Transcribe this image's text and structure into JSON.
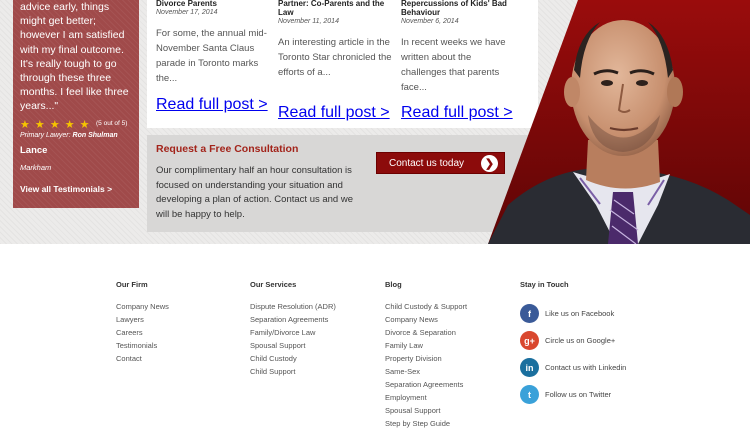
{
  "testimonial": {
    "quote": "advice early, things might get better; however I am satisfied with my final outcome. It's really tough to go through these three months. I feel like three years...\"",
    "stars": "★ ★ ★ ★ ★",
    "rating_text": "(5 out of 5)",
    "primary_label": "Primary Lawyer:",
    "primary_name": "Ron Shulman",
    "name": "Lance",
    "city": "Markham",
    "view_all": "View all Testimonials >"
  },
  "blogs": [
    {
      "title": "Divorce Parents",
      "date": "November 17, 2014",
      "excerpt": "For some, the annual mid-November Santa Claus parade in Toronto marks the...",
      "read_more": "Read full post >"
    },
    {
      "title": "Partner: Co-Parents and the Law",
      "date": "November 11, 2014",
      "excerpt": "An interesting article in the Toronto Star chronicled the efforts of a...",
      "read_more": "Read full post >"
    },
    {
      "title": "Repercussions of Kids' Bad Behaviour",
      "date": "November 6, 2014",
      "excerpt": "In recent weeks we have written about the challenges that parents face...",
      "read_more": "Read full post >"
    }
  ],
  "consultation": {
    "title": "Request a Free Consultation",
    "text": "Our complimentary half an hour consultation is focused on understanding your situation and developing a plan of action. Contact us and we will be happy to help.",
    "button": "Contact us today",
    "button_arrow": "❯"
  },
  "footer": {
    "firm": {
      "heading": "Our Firm",
      "links": [
        "Company News",
        "Lawyers",
        "Careers",
        "Testimonials",
        "Contact"
      ]
    },
    "services": {
      "heading": "Our Services",
      "links": [
        "Dispute Resolution (ADR)",
        "Separation Agreements",
        "Family/Divorce Law",
        "Spousal Support",
        "Child Custody",
        "Child Support"
      ]
    },
    "blog": {
      "heading": "Blog",
      "links": [
        "Child Custody & Support",
        "Company News",
        "Divorce & Separation",
        "Family Law",
        "Property Division",
        "Same-Sex",
        "Separation Agreements",
        "Employment",
        "Spousal Support",
        "Step by Step Guide"
      ]
    },
    "stay": {
      "heading": "Stay in Touch",
      "items": [
        {
          "icon": "facebook-icon",
          "glyph": "f",
          "label": "Like us on Facebook"
        },
        {
          "icon": "google-plus-icon",
          "glyph": "g+",
          "label": "Circle us on Google+"
        },
        {
          "icon": "linkedin-icon",
          "glyph": "in",
          "label": "Contact us with Linkedin"
        },
        {
          "icon": "twitter-icon",
          "glyph": "t",
          "label": "Follow us on Twitter"
        }
      ]
    }
  },
  "colors": {
    "accent_red": "#a3241b",
    "button_red": "#8c0b0b",
    "testimonial_bg": "#a04a4a",
    "star": "#f5c400"
  }
}
